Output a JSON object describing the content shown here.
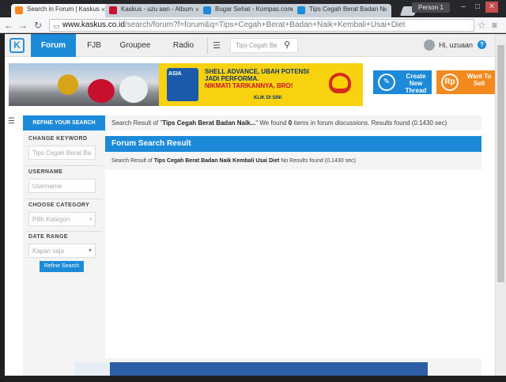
{
  "browser": {
    "tabs": [
      {
        "title": "Search in Forum | Kaskus",
        "active": true,
        "favicon_color": "#f48a1e"
      },
      {
        "title": "Kaskus - uzu aan - Album",
        "active": false,
        "favicon_color": "#c8102e"
      },
      {
        "title": "Bugar Sehat - Kompas.com",
        "active": false,
        "favicon_color": "#1c8ad9"
      },
      {
        "title": "Tips Cegah Berat Badan N",
        "active": false,
        "favicon_color": "#1c8ad9"
      }
    ],
    "profile_label": "Person 1",
    "window_buttons": {
      "minimize": "–",
      "maximize": "□",
      "close": "✕"
    },
    "url_host": "www.kaskus.co.id",
    "url_path": "/search/forum?f=forum&q=Tips+Cegah+Berat+Badan+Naik+Kembali+Usai+Diet",
    "icons": {
      "back": "←",
      "forward": "→",
      "reload": "↻",
      "lock": "▭",
      "star": "☆",
      "menu": "≡"
    }
  },
  "site": {
    "logo_letter": "K",
    "nav": {
      "forum": "Forum",
      "fjb": "FJB",
      "groupee": "Groupee",
      "radio": "Radio"
    },
    "search_placeholder": "Tips Cegah Be",
    "greeting": "Hi, uzuaan",
    "help": "?",
    "list_icon": "☰",
    "search_icon": "⚲"
  },
  "banner": {
    "can_text": "ASIA",
    "line1": "SHELL ADVANCE, UBAH POTENSI",
    "line2": "JADI PERFORMA.",
    "line3": "NIKMATI TARIKANNYA, BRO!",
    "cta": "KLIK DI SINI"
  },
  "actions": {
    "create_thread": "Create New Thread",
    "create_thread_icon": "✎",
    "want_sell": "Want To Sell",
    "want_sell_icon": "Rp"
  },
  "filter_bar": {
    "toggle_icon": "☰",
    "refine_tab": "REFINE YOUR SEARCH",
    "summary_prefix": "Search Result of \"",
    "summary_query": "Tips Cegah Berat Badan Naik...",
    "summary_mid": "\" We found ",
    "summary_count": "0",
    "summary_suffix": " items in forum discussions. Results found (0.1430 sec)"
  },
  "sidebar": {
    "keyword_label": "CHANGE KEYWORD",
    "keyword_value": "Tips Cegah Berat Ba",
    "username_label": "USERNAME",
    "username_placeholder": "Username",
    "category_label": "CHOOSE CATEGORY",
    "category_value": "Pilih Kategori",
    "date_label": "DATE RANGE",
    "date_value": "Kapan saja",
    "refine_button": "Refine Search",
    "caret_right": "›",
    "caret_down": "▾"
  },
  "results": {
    "title": "Forum Search Result",
    "body_prefix": "Search Result of ",
    "body_query": "Tips Cegah Berat Badan Naik Kembali Usai Diet",
    "body_suffix": " No Results found (0.1430 sec)"
  }
}
